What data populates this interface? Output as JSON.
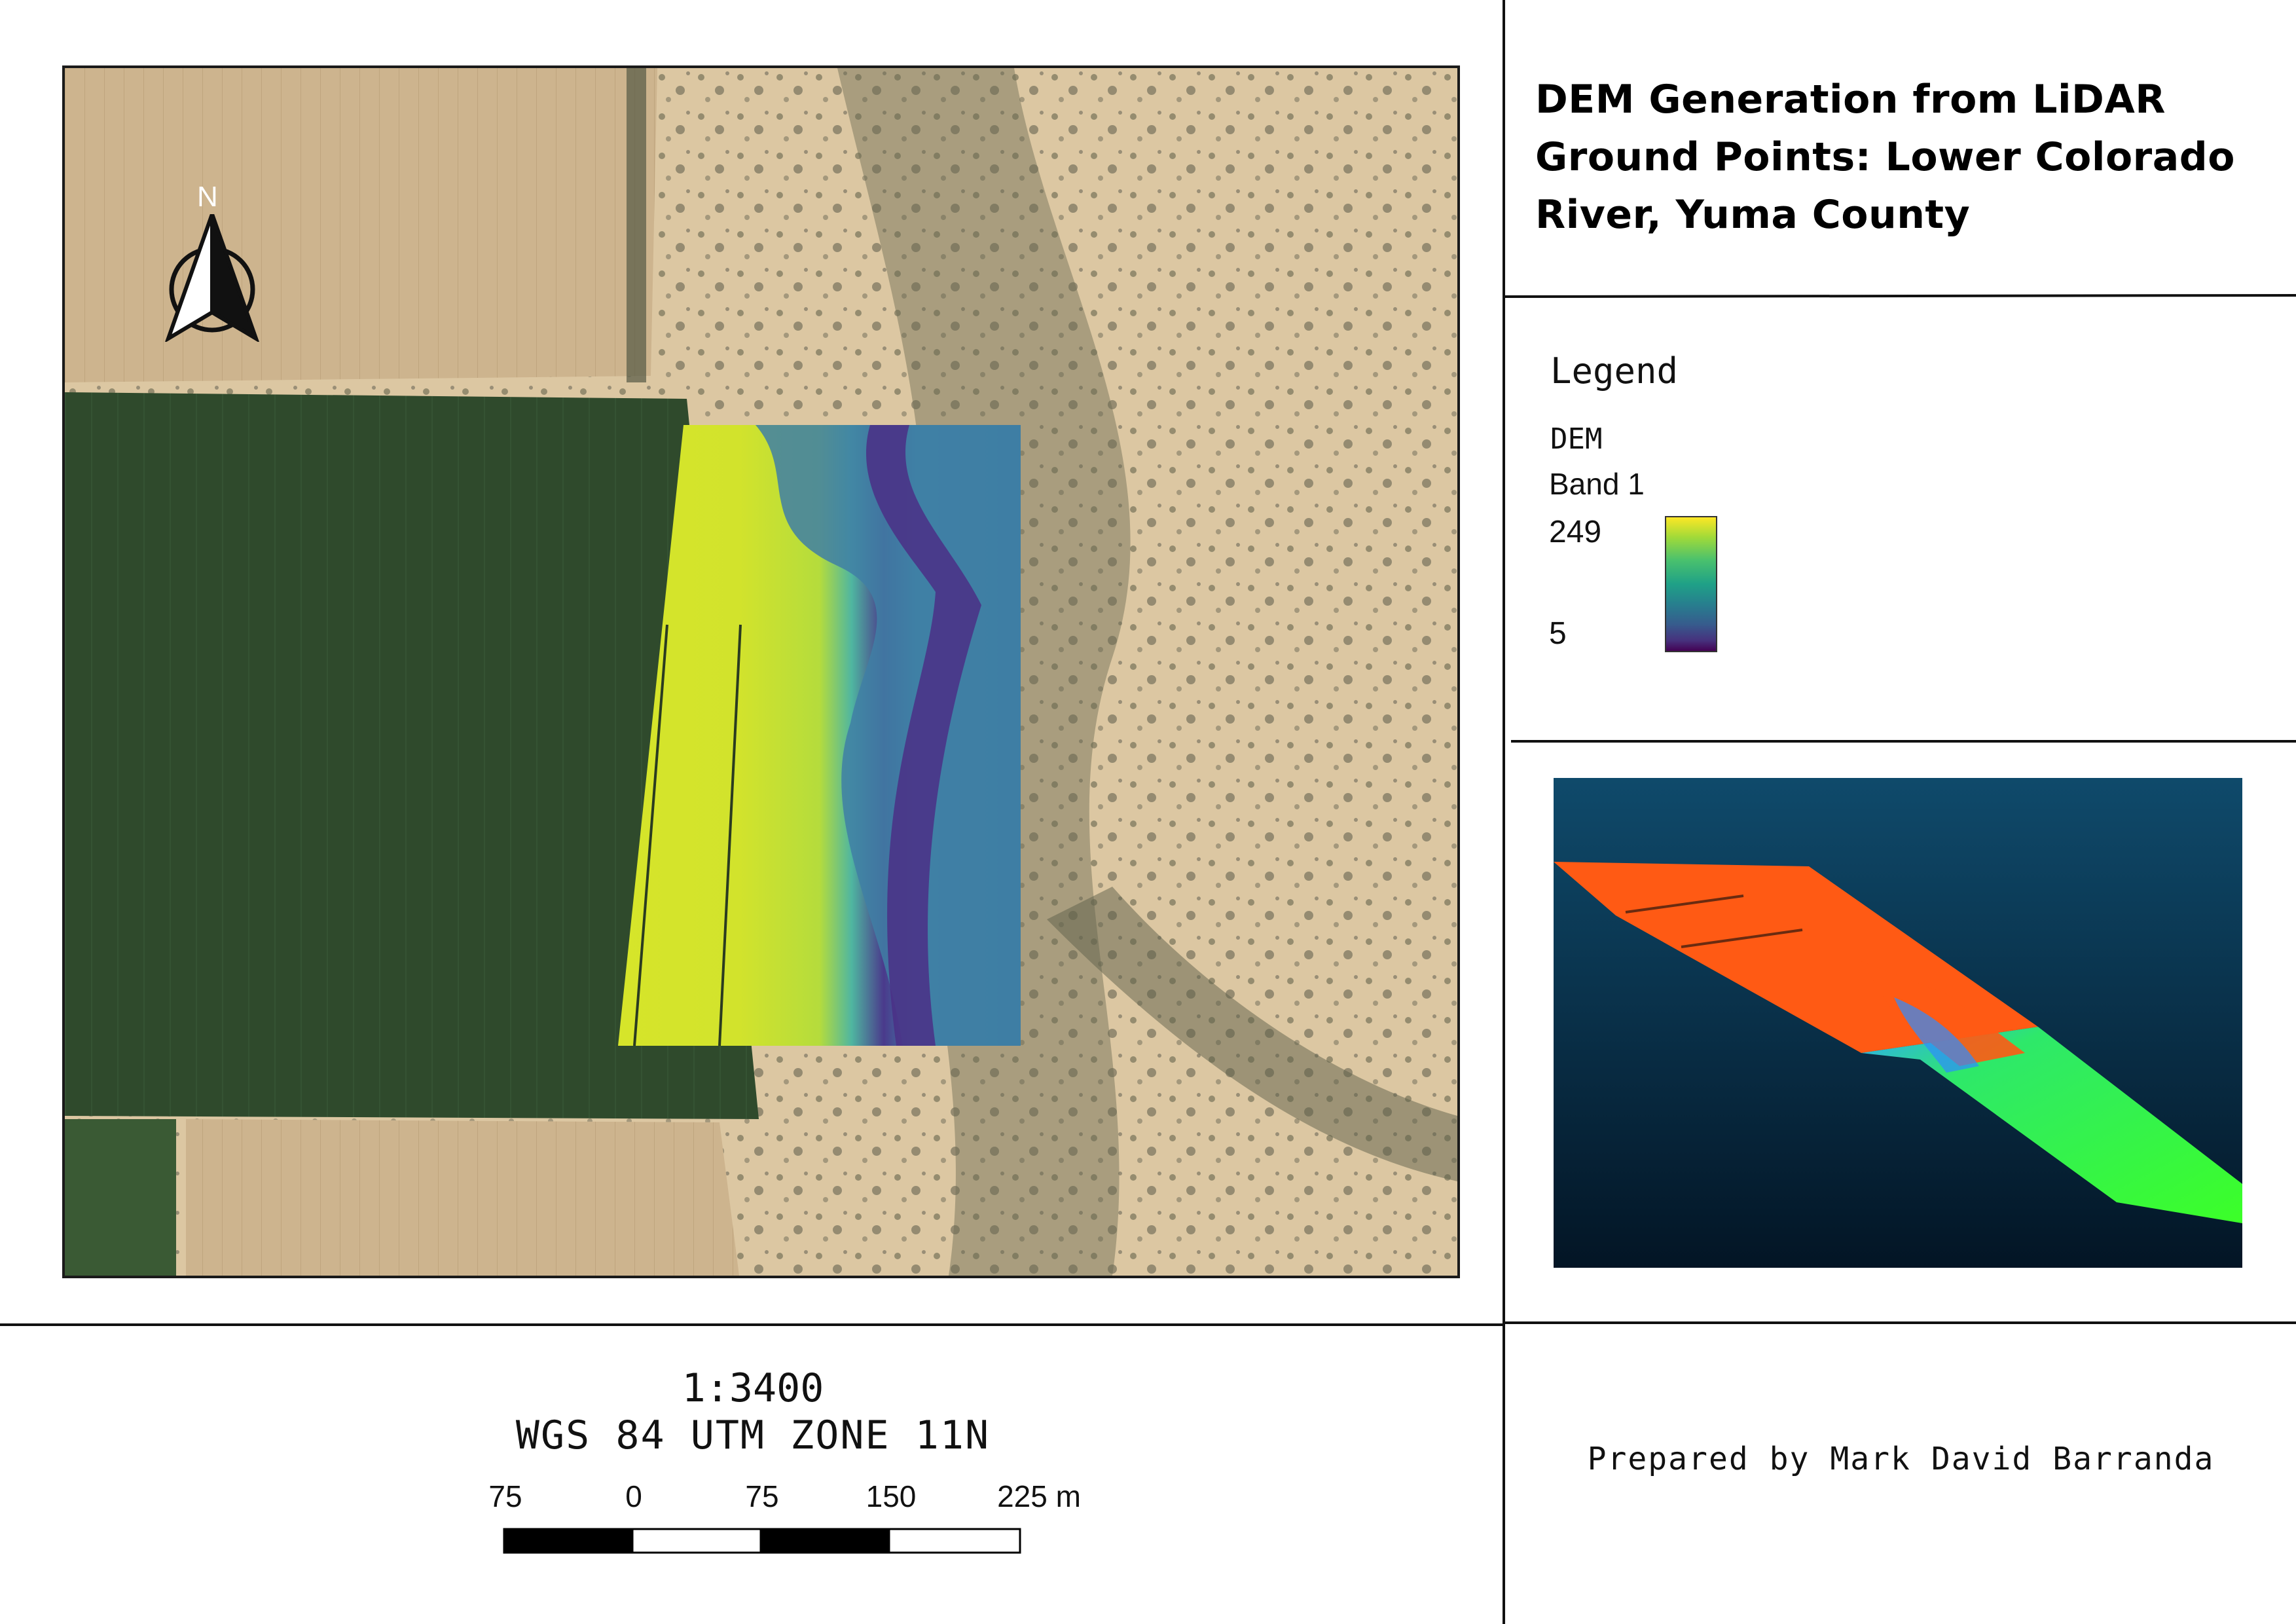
{
  "map": {
    "title": "DEM Generation from LiDAR Ground Points: Lower Colorado River, Yuma County",
    "north_label": "N",
    "scale_text": "1:3400",
    "crs_text": "WGS 84 UTM ZONE 11N",
    "scale_bar": {
      "ticks": [
        "75",
        "0",
        "75",
        "150",
        "225 m"
      ],
      "unit": "m"
    },
    "credit": "Prepared by Mark David Barranda"
  },
  "legend": {
    "heading": "Legend",
    "layer_name": "DEM",
    "band_name": "Band 1",
    "max_value": "249",
    "min_value": "5",
    "ramp_colors": [
      "#fde725",
      "#a0da39",
      "#4ac16d",
      "#1fa187",
      "#277f8e",
      "#365c8d",
      "#46327e",
      "#440154"
    ]
  },
  "colors": {
    "farmland_green": "#2f4a2c",
    "fallow_field": "#cdb48e",
    "desert_sand": "#dcc7a2",
    "inset_background_top": "#0f4a6b",
    "inset_background_bottom": "#031525",
    "point_cloud_orange": "#ff5a14",
    "point_cloud_green": "#3cff28"
  },
  "icons": {
    "north_arrow": "north-arrow-icon"
  }
}
